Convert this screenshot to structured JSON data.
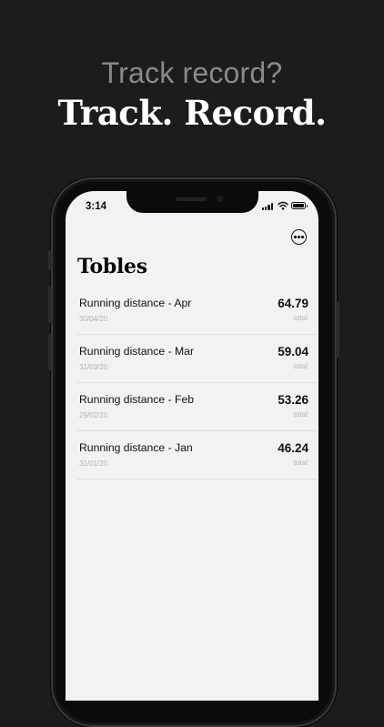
{
  "marketing": {
    "question": "Track record?",
    "headline": "Track. Record."
  },
  "status_bar": {
    "time": "3:14",
    "icons": [
      "signal-icon",
      "wifi-icon",
      "battery-icon"
    ]
  },
  "app": {
    "title": "Tobles",
    "more_icon": "ellipsis-circle-icon"
  },
  "tables": [
    {
      "name": "Running distance - Apr",
      "date": "30/04/20",
      "value": "64.79",
      "unit": "total"
    },
    {
      "name": "Running distance - Mar",
      "date": "31/03/20",
      "value": "59.04",
      "unit": "total"
    },
    {
      "name": "Running distance - Feb",
      "date": "29/02/20",
      "value": "53.26",
      "unit": "total"
    },
    {
      "name": "Running distance - Jan",
      "date": "31/01/20",
      "value": "46.24",
      "unit": "total"
    }
  ]
}
